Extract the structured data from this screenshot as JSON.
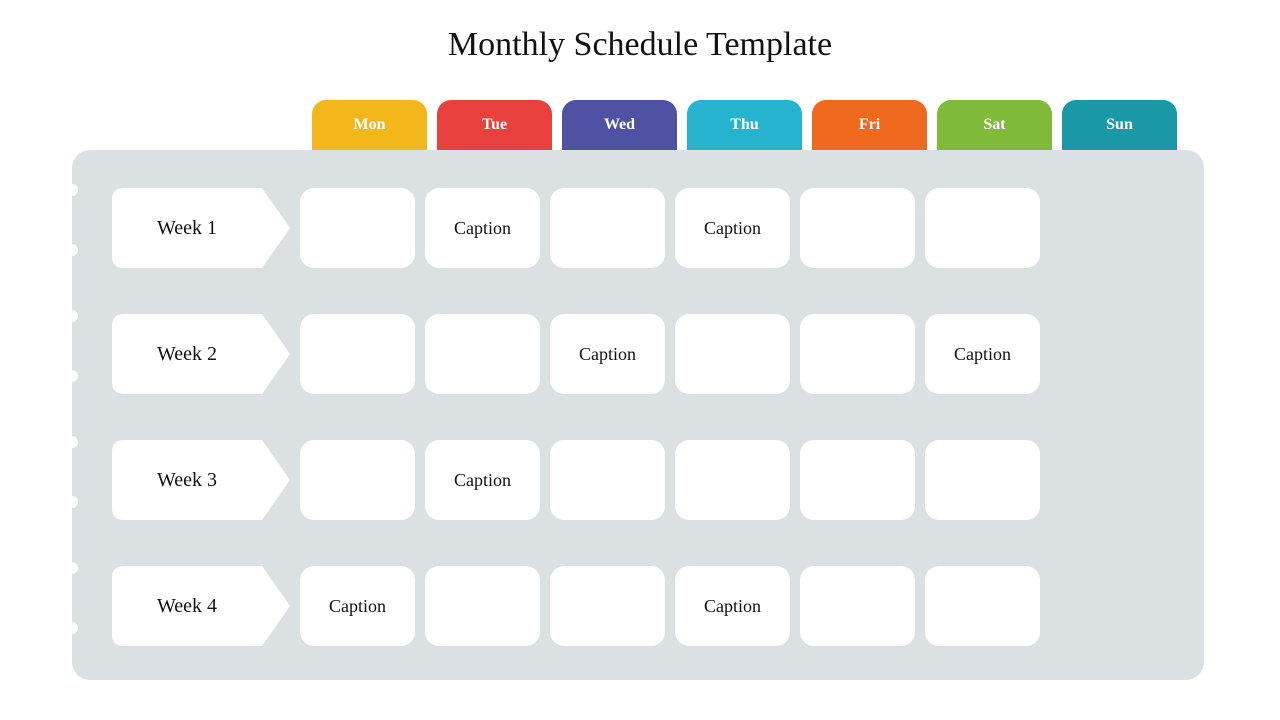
{
  "title": "Monthly Schedule Template",
  "days": [
    {
      "label": "Mon",
      "color": "#f3b71c"
    },
    {
      "label": "Tue",
      "color": "#e8403c"
    },
    {
      "label": "Wed",
      "color": "#4f52a3"
    },
    {
      "label": "Thu",
      "color": "#26b3cf"
    },
    {
      "label": "Fri",
      "color": "#ef6a1f"
    },
    {
      "label": "Sat",
      "color": "#7fba3a"
    },
    {
      "label": "Sun",
      "color": "#1a98a6"
    }
  ],
  "weeks": [
    {
      "label": "Week 1",
      "cells": [
        "",
        "Caption",
        "",
        "Caption",
        "",
        ""
      ]
    },
    {
      "label": "Week 2",
      "cells": [
        "",
        "",
        "Caption",
        "",
        "",
        "Caption"
      ]
    },
    {
      "label": "Week 3",
      "cells": [
        "",
        "Caption",
        "",
        "",
        "",
        ""
      ]
    },
    {
      "label": "Week 4",
      "cells": [
        "Caption",
        "",
        "",
        "Caption",
        "",
        ""
      ]
    }
  ],
  "cols_per_row": 6,
  "holes": [
    34,
    94,
    160,
    220,
    286,
    346,
    412,
    472
  ]
}
